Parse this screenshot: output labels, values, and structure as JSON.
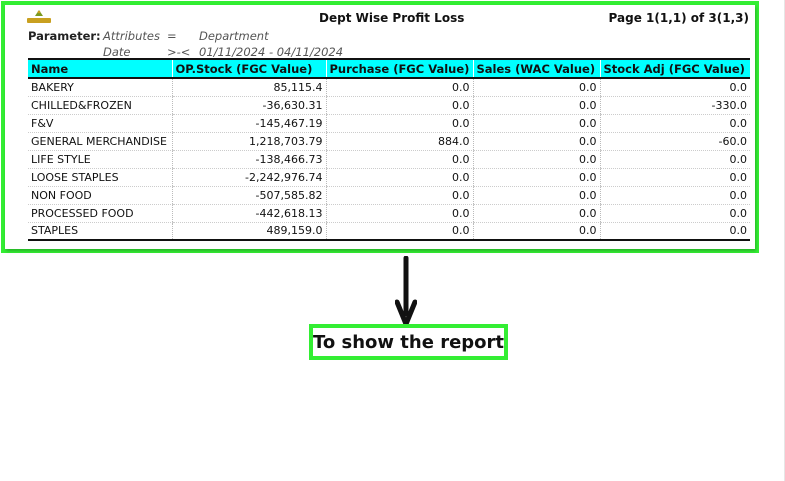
{
  "report": {
    "title": "Dept Wise Profit Loss",
    "page_info": "Page 1(1,1) of 3(1,3)",
    "logo_icon": "company-logo-icon",
    "parameters": {
      "label": "Parameter:",
      "rows": [
        {
          "key": "Attributes",
          "operator": "=",
          "value": "Department"
        },
        {
          "key": "Date",
          "operator": ">-<",
          "value": "01/11/2024 - 04/11/2024"
        }
      ]
    },
    "table": {
      "header_color": "#00ffff",
      "columns": [
        "Name",
        "OP.Stock (FGC Value)",
        "Purchase (FGC Value)",
        "Sales (WAC Value)",
        "Stock Adj (FGC Value)"
      ],
      "rows": [
        [
          "BAKERY",
          "85,115.4",
          "0.0",
          "0.0",
          "0.0"
        ],
        [
          "CHILLED&FROZEN",
          "-36,630.31",
          "0.0",
          "0.0",
          "-330.0"
        ],
        [
          "F&V",
          "-145,467.19",
          "0.0",
          "0.0",
          "0.0"
        ],
        [
          "GENERAL MERCHANDISE",
          "1,218,703.79",
          "884.0",
          "0.0",
          "-60.0"
        ],
        [
          "LIFE STYLE",
          "-138,466.73",
          "0.0",
          "0.0",
          "0.0"
        ],
        [
          "LOOSE STAPLES",
          "-2,242,976.74",
          "0.0",
          "0.0",
          "0.0"
        ],
        [
          "NON FOOD",
          "-507,585.82",
          "0.0",
          "0.0",
          "0.0"
        ],
        [
          "PROCESSED FOOD",
          "-442,618.13",
          "0.0",
          "0.0",
          "0.0"
        ],
        [
          "STAPLES",
          "489,159.0",
          "0.0",
          "0.0",
          "0.0"
        ]
      ]
    }
  },
  "annotation": {
    "callout_text": "To show the report",
    "highlight_color": "#33ee33",
    "arrow_icon": "arrow-down-icon"
  }
}
